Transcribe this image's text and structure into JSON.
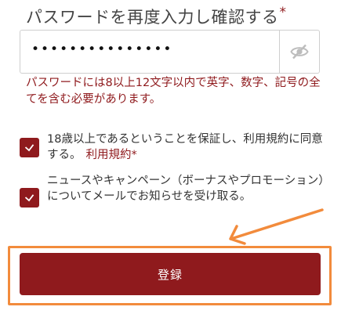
{
  "confirm_password": {
    "label": "パスワードを再度入力し確認する",
    "required_mark": "*",
    "value": "•••••••••••••••",
    "toggle_icon": "eye-slash-icon",
    "hint": "パスワードには8以上12文字以内で英字、数字、記号の全てを含む必要があります。"
  },
  "consents": [
    {
      "text": "18歳以上であるということを保証し、利用規約に同意する。",
      "link": "利用規約",
      "required_mark": "*",
      "checked": true
    },
    {
      "text": "ニュースやキャンペーン（ボーナスやプロモーション）についてメールでお知らせを受け取る。",
      "checked": true
    }
  ],
  "submit_label": "登録",
  "colors": {
    "brand": "#8f1a1d",
    "annotation": "#f28b3c",
    "border": "#cfcfcf"
  }
}
